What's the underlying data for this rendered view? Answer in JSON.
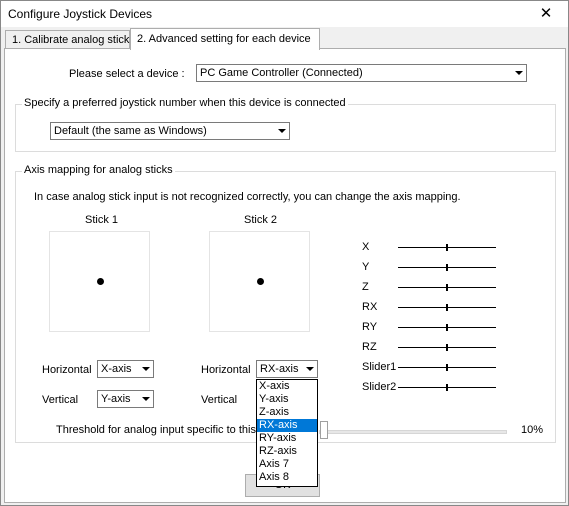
{
  "window": {
    "title": "Configure Joystick Devices",
    "close_glyph": "✕"
  },
  "tabs": [
    {
      "label": "1. Calibrate analog stick",
      "active": false
    },
    {
      "label": "2. Advanced setting for each device",
      "active": true
    }
  ],
  "device": {
    "label": "Please select a device :",
    "selected": "PC Game Controller (Connected)"
  },
  "joystick_number": {
    "group_title": "Specify a preferred joystick number when this device is connected",
    "selected": "Default (the same as Windows)"
  },
  "axis_mapping": {
    "group_title": "Axis mapping for analog sticks",
    "description": "In case analog stick input is not recognized correctly, you can change the axis mapping.",
    "stick1": {
      "title": "Stick 1",
      "horizontal_label": "Horizontal",
      "horizontal_value": "X-axis",
      "vertical_label": "Vertical",
      "vertical_value": "Y-axis"
    },
    "stick2": {
      "title": "Stick 2",
      "horizontal_label": "Horizontal",
      "horizontal_value": "RX-axis",
      "vertical_label": "Vertical"
    },
    "axes": [
      {
        "label": "X",
        "level": 0.5
      },
      {
        "label": "Y",
        "level": 0.5
      },
      {
        "label": "Z",
        "level": 0.5
      },
      {
        "label": "RX",
        "level": 0.5
      },
      {
        "label": "RY",
        "level": 0.5
      },
      {
        "label": "RZ",
        "level": 0.5
      },
      {
        "label": "Slider1",
        "level": 0.5
      },
      {
        "label": "Slider2",
        "level": 0.5
      }
    ],
    "dropdown_options": [
      {
        "label": "X-axis",
        "selected": false
      },
      {
        "label": "Y-axis",
        "selected": false
      },
      {
        "label": "Z-axis",
        "selected": false
      },
      {
        "label": "RX-axis",
        "selected": true
      },
      {
        "label": "RY-axis",
        "selected": false
      },
      {
        "label": "RZ-axis",
        "selected": false
      },
      {
        "label": "Axis 7",
        "selected": false
      },
      {
        "label": "Axis 8",
        "selected": false
      }
    ],
    "threshold_label": "Threshold for analog input specific to this",
    "threshold_value": "10%",
    "threshold_level": 0.1
  },
  "buttons": {
    "ok": "OK"
  },
  "colors": {
    "selection": "#0078d7"
  }
}
